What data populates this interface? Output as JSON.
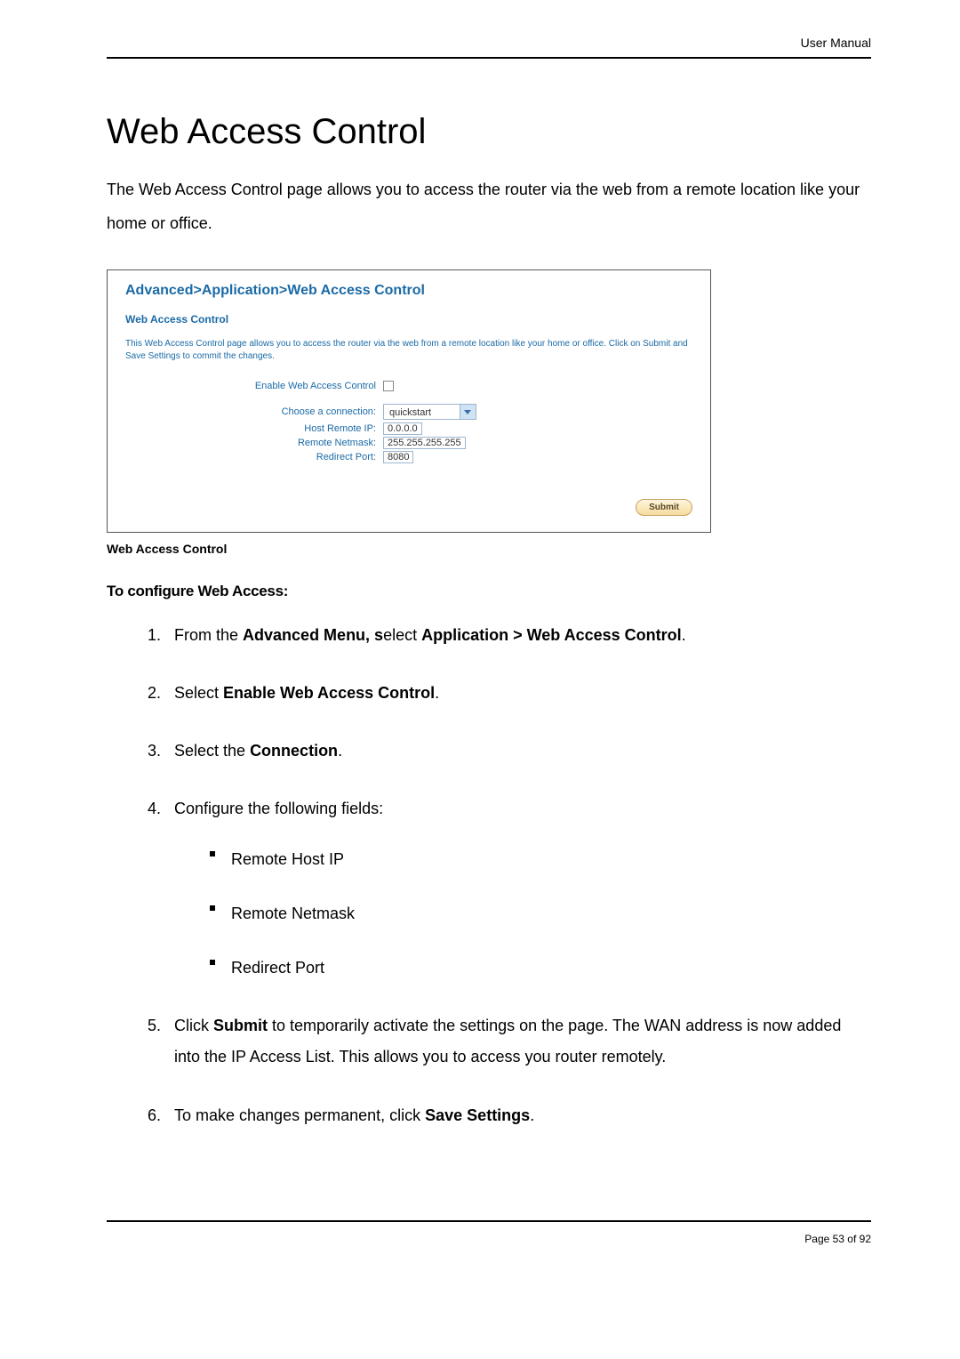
{
  "header": {
    "right": "User Manual"
  },
  "heading": "Web Access Control",
  "intro": "The Web Access Control page allows you to access the router via the web from a remote location like your home or office.",
  "screenshot": {
    "breadcrumb": "Advanced>Application>Web Access Control",
    "section_title": "Web Access Control",
    "description": "This Web Access Control page allows you to access the router via the web from a remote location like your home or office. Click on Submit and Save Settings to commit the changes.",
    "fields": {
      "enable_label": "Enable Web Access Control",
      "choose_label": "Choose a connection:",
      "choose_value": "quickstart",
      "host_ip_label": "Host Remote IP:",
      "host_ip_value": "0.0.0.0",
      "netmask_label": "Remote Netmask:",
      "netmask_value": "255.255.255.255",
      "port_label": "Redirect Port:",
      "port_value": "8080"
    },
    "submit_label": "Submit"
  },
  "caption": "Web Access Control",
  "configure_head": "To configure Web Access:",
  "steps": {
    "s1_pre": "From the ",
    "s1_bold1": "Advanced Menu, s",
    "s1_mid": "elect ",
    "s1_bold2": "Application > Web Access Control",
    "s1_post": ".",
    "s2_pre": "Select ",
    "s2_bold": "Enable Web Access Control",
    "s2_post": ".",
    "s3_pre": "Select the ",
    "s3_bold": "Connection",
    "s3_post": ".",
    "s4": "Configure the following fields:",
    "sub1": "Remote Host IP",
    "sub2": "Remote Netmask",
    "sub3": "Redirect Port",
    "s5_pre": "Click ",
    "s5_bold": "Submit",
    "s5_post": " to temporarily activate the settings on the page. The WAN address is now added into the IP Access List. This allows you to access you router remotely.",
    "s6_pre": "To make changes permanent, click ",
    "s6_bold": "Save Settings",
    "s6_post": "."
  },
  "footer": {
    "page": "Page 53 of 92"
  }
}
